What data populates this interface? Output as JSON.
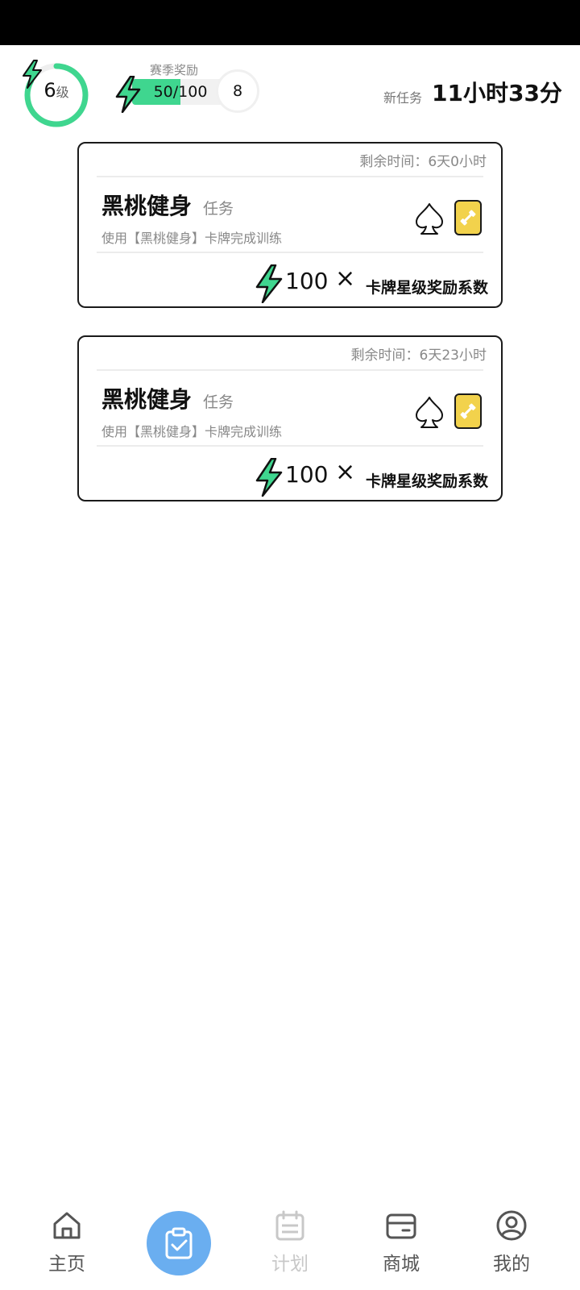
{
  "header": {
    "level": {
      "number": "6",
      "unit": "级",
      "progress": 0.83
    },
    "season": {
      "label": "赛季奖励",
      "progress_text": "50/100",
      "progress": 0.5,
      "next_level": "8"
    },
    "new_task": {
      "label": "新任务",
      "time": "11小时33分"
    }
  },
  "tasks": [
    {
      "remaining": "剩余时间：6天0小时",
      "title": "黑桃健身",
      "tag": "任务",
      "description": "使用【黑桃健身】卡牌完成训练",
      "reward_value": "100",
      "reward_times": "×",
      "reward_label": "卡牌星级奖励系数"
    },
    {
      "remaining": "剩余时间：6天23小时",
      "title": "黑桃健身",
      "tag": "任务",
      "description": "使用【黑桃健身】卡牌完成训练",
      "reward_value": "100",
      "reward_times": "×",
      "reward_label": "卡牌星级奖励系数"
    }
  ],
  "nav": {
    "home": "主页",
    "plan": "计划",
    "shop": "商城",
    "mine": "我的",
    "active": "tasks"
  },
  "colors": {
    "accent_green": "#3fd68f",
    "nav_active": "#6aaef0",
    "card_yellow": "#f2d24c"
  }
}
